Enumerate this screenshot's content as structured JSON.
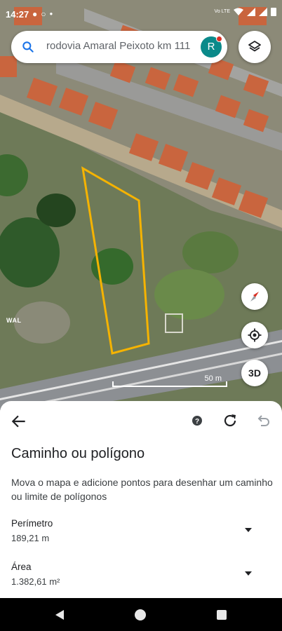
{
  "status_bar": {
    "time": "14:27",
    "left_icons": [
      "messenger-icon",
      "whatsapp-icon",
      "dot-icon"
    ],
    "network_label": "Vo LTE",
    "right_icons": [
      "wifi-icon",
      "signal-icon",
      "signal-icon",
      "battery-icon"
    ]
  },
  "search": {
    "query": "rodovia Amaral Peixoto km 111",
    "avatar_letter": "R",
    "avatar_color": "#0b8a8a"
  },
  "map": {
    "watermark": "WAL",
    "scale_label": "50 m",
    "threed_label": "3D",
    "polygon_color": "#f5b301"
  },
  "sheet": {
    "title": "Caminho ou polígono",
    "description": "Mova o mapa e adicione pontos para desenhar um caminho ou limite de polígonos",
    "perimeter_label": "Perímetro",
    "perimeter_value": "189,21 m",
    "area_label": "Área",
    "area_value": "1.382,61 m²"
  },
  "icons": {
    "back": "arrow-left-icon",
    "help": "help-icon",
    "reset": "refresh-icon",
    "undo": "undo-icon",
    "layers": "layers-icon",
    "compass": "compass-icon",
    "location": "my-location-icon"
  }
}
